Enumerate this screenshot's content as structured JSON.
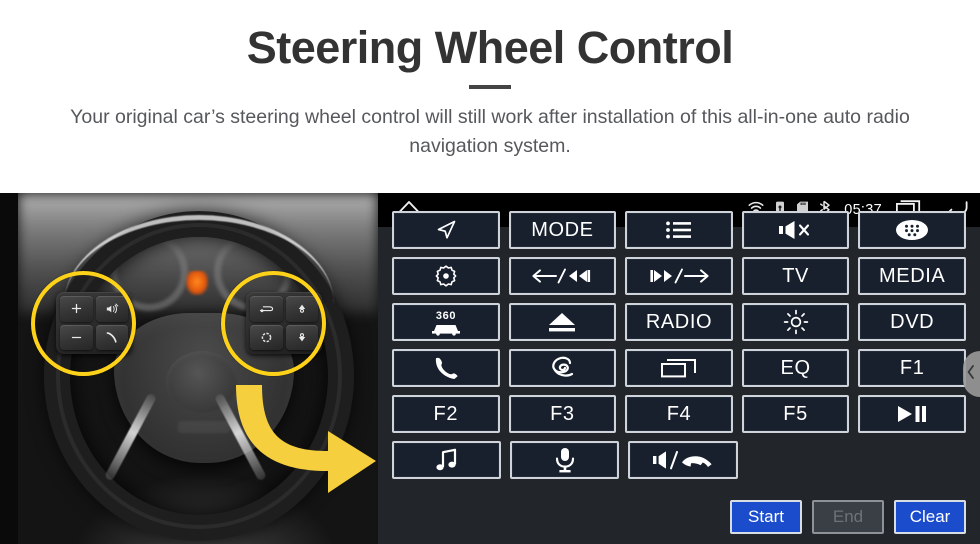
{
  "header": {
    "title": "Steering Wheel Control",
    "subtitle": "Your original car’s steering wheel control will still work after installation of this all-in-one auto radio navigation system."
  },
  "colors": {
    "accent_yellow": "#ffd21a",
    "primary_blue": "#1a4ccc",
    "panel_bg": "#22262b",
    "button_bg": "#18202e",
    "button_border": "#cfd4da",
    "title_text": "#333333"
  },
  "photo": {
    "alt": "steering-wheel-photo",
    "left_cluster_keys": [
      {
        "name": "volume-up-key",
        "label": "+"
      },
      {
        "name": "mute-speaker-key",
        "label": ""
      },
      {
        "name": "volume-down-key",
        "label": "−"
      },
      {
        "name": "phone-call-key",
        "label": ""
      }
    ],
    "right_cluster_keys": [
      {
        "name": "cruise-control-key",
        "label": ""
      },
      {
        "name": "arrow-up-key",
        "label": ""
      },
      {
        "name": "circle-key",
        "label": ""
      },
      {
        "name": "arrow-down-key",
        "label": ""
      }
    ]
  },
  "radio": {
    "statusbar": {
      "home_icon": "home-icon",
      "wifi_icon": "wifi-icon",
      "usb_icon": "usb-icon",
      "sdcard_icon": "sdcard-icon",
      "bluetooth_icon": "bluetooth-icon",
      "clock": "05:37",
      "recents_icon": "recents-icon",
      "back_icon": "back-icon"
    },
    "rows": [
      [
        {
          "name": "nav-button",
          "label": "",
          "icon": "navigation-arrow-icon"
        },
        {
          "name": "mode-button",
          "label": "MODE",
          "icon": ""
        },
        {
          "name": "list-button",
          "label": "",
          "icon": "list-icon"
        },
        {
          "name": "mute-button",
          "label": "",
          "icon": "mute-icon"
        },
        {
          "name": "apps-button",
          "label": "",
          "icon": "apps-grid-icon"
        }
      ],
      [
        {
          "name": "settings-button",
          "label": "",
          "icon": "gear-dot-icon"
        },
        {
          "name": "prev-track-button",
          "label": "",
          "icon": "prev-track-icon"
        },
        {
          "name": "next-track-button",
          "label": "",
          "icon": "next-track-icon"
        },
        {
          "name": "tv-button",
          "label": "TV",
          "icon": ""
        },
        {
          "name": "media-button",
          "label": "MEDIA",
          "icon": ""
        }
      ],
      [
        {
          "name": "camera-360-button",
          "label": "",
          "icon": "camera-360-icon"
        },
        {
          "name": "eject-button",
          "label": "",
          "icon": "eject-icon"
        },
        {
          "name": "radio-button",
          "label": "RADIO",
          "icon": ""
        },
        {
          "name": "brightness-button",
          "label": "",
          "icon": "brightness-icon"
        },
        {
          "name": "dvd-button",
          "label": "DVD",
          "icon": ""
        }
      ],
      [
        {
          "name": "phone-button",
          "label": "",
          "icon": "phone-icon"
        },
        {
          "name": "swirl-button",
          "label": "",
          "icon": "swirl-icon"
        },
        {
          "name": "window-button",
          "label": "",
          "icon": "window-icon"
        },
        {
          "name": "eq-button",
          "label": "EQ",
          "icon": ""
        },
        {
          "name": "f1-button",
          "label": "F1",
          "icon": ""
        }
      ],
      [
        {
          "name": "f2-button",
          "label": "F2",
          "icon": ""
        },
        {
          "name": "f3-button",
          "label": "F3",
          "icon": ""
        },
        {
          "name": "f4-button",
          "label": "F4",
          "icon": ""
        },
        {
          "name": "f5-button",
          "label": "F5",
          "icon": ""
        },
        {
          "name": "play-pause-button",
          "label": "",
          "icon": "play-pause-icon"
        }
      ],
      [
        {
          "name": "music-button",
          "label": "",
          "icon": "music-note-icon"
        },
        {
          "name": "voice-button",
          "label": "",
          "icon": "microphone-icon"
        },
        {
          "name": "volume-hangup-button",
          "label": "",
          "icon": "volume-hangup-icon"
        }
      ]
    ],
    "footer": {
      "start_label": "Start",
      "end_label": "End",
      "clear_label": "Clear"
    },
    "drawer_handle_icon": "chevron-left-icon"
  }
}
